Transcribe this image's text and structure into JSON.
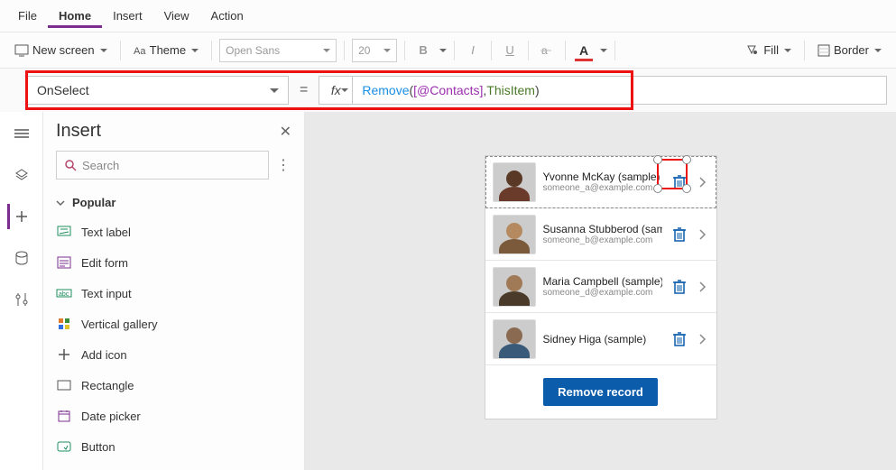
{
  "menubar": [
    "File",
    "Home",
    "Insert",
    "View",
    "Action"
  ],
  "menubar_active": 1,
  "ribbon": {
    "new_screen": "New screen",
    "theme": "Theme",
    "font": "Open Sans",
    "font_size": "20",
    "bold": "B",
    "italic": "I",
    "underline": "U",
    "fontcolor": "A",
    "fill": "Fill",
    "border": "Border"
  },
  "formula": {
    "property": "OnSelect",
    "fx": "fx",
    "tokens": {
      "fn": "Remove",
      "open": "(",
      "space": " ",
      "ds": "[@Contacts]",
      "comma": ",",
      "kw": "ThisItem",
      "close": ")"
    }
  },
  "insert": {
    "title": "Insert",
    "search_placeholder": "Search",
    "section": "Popular",
    "items": [
      {
        "label": "Text label",
        "icon": "text-label-icon"
      },
      {
        "label": "Edit form",
        "icon": "edit-form-icon"
      },
      {
        "label": "Text input",
        "icon": "text-input-icon"
      },
      {
        "label": "Vertical gallery",
        "icon": "vertical-gallery-icon"
      },
      {
        "label": "Add icon",
        "icon": "add-icon-icon"
      },
      {
        "label": "Rectangle",
        "icon": "rectangle-icon"
      },
      {
        "label": "Date picker",
        "icon": "date-picker-icon"
      },
      {
        "label": "Button",
        "icon": "button-icon"
      }
    ]
  },
  "gallery": {
    "rows": [
      {
        "name": "Yvonne McKay (sample)",
        "email": "someone_a@example.com"
      },
      {
        "name": "Susanna Stubberod (sample)",
        "email": "someone_b@example.com"
      },
      {
        "name": "Maria Campbell (sample)",
        "email": "someone_d@example.com"
      },
      {
        "name": "Sidney Higa (sample)",
        "email": ""
      }
    ],
    "button": "Remove record"
  }
}
